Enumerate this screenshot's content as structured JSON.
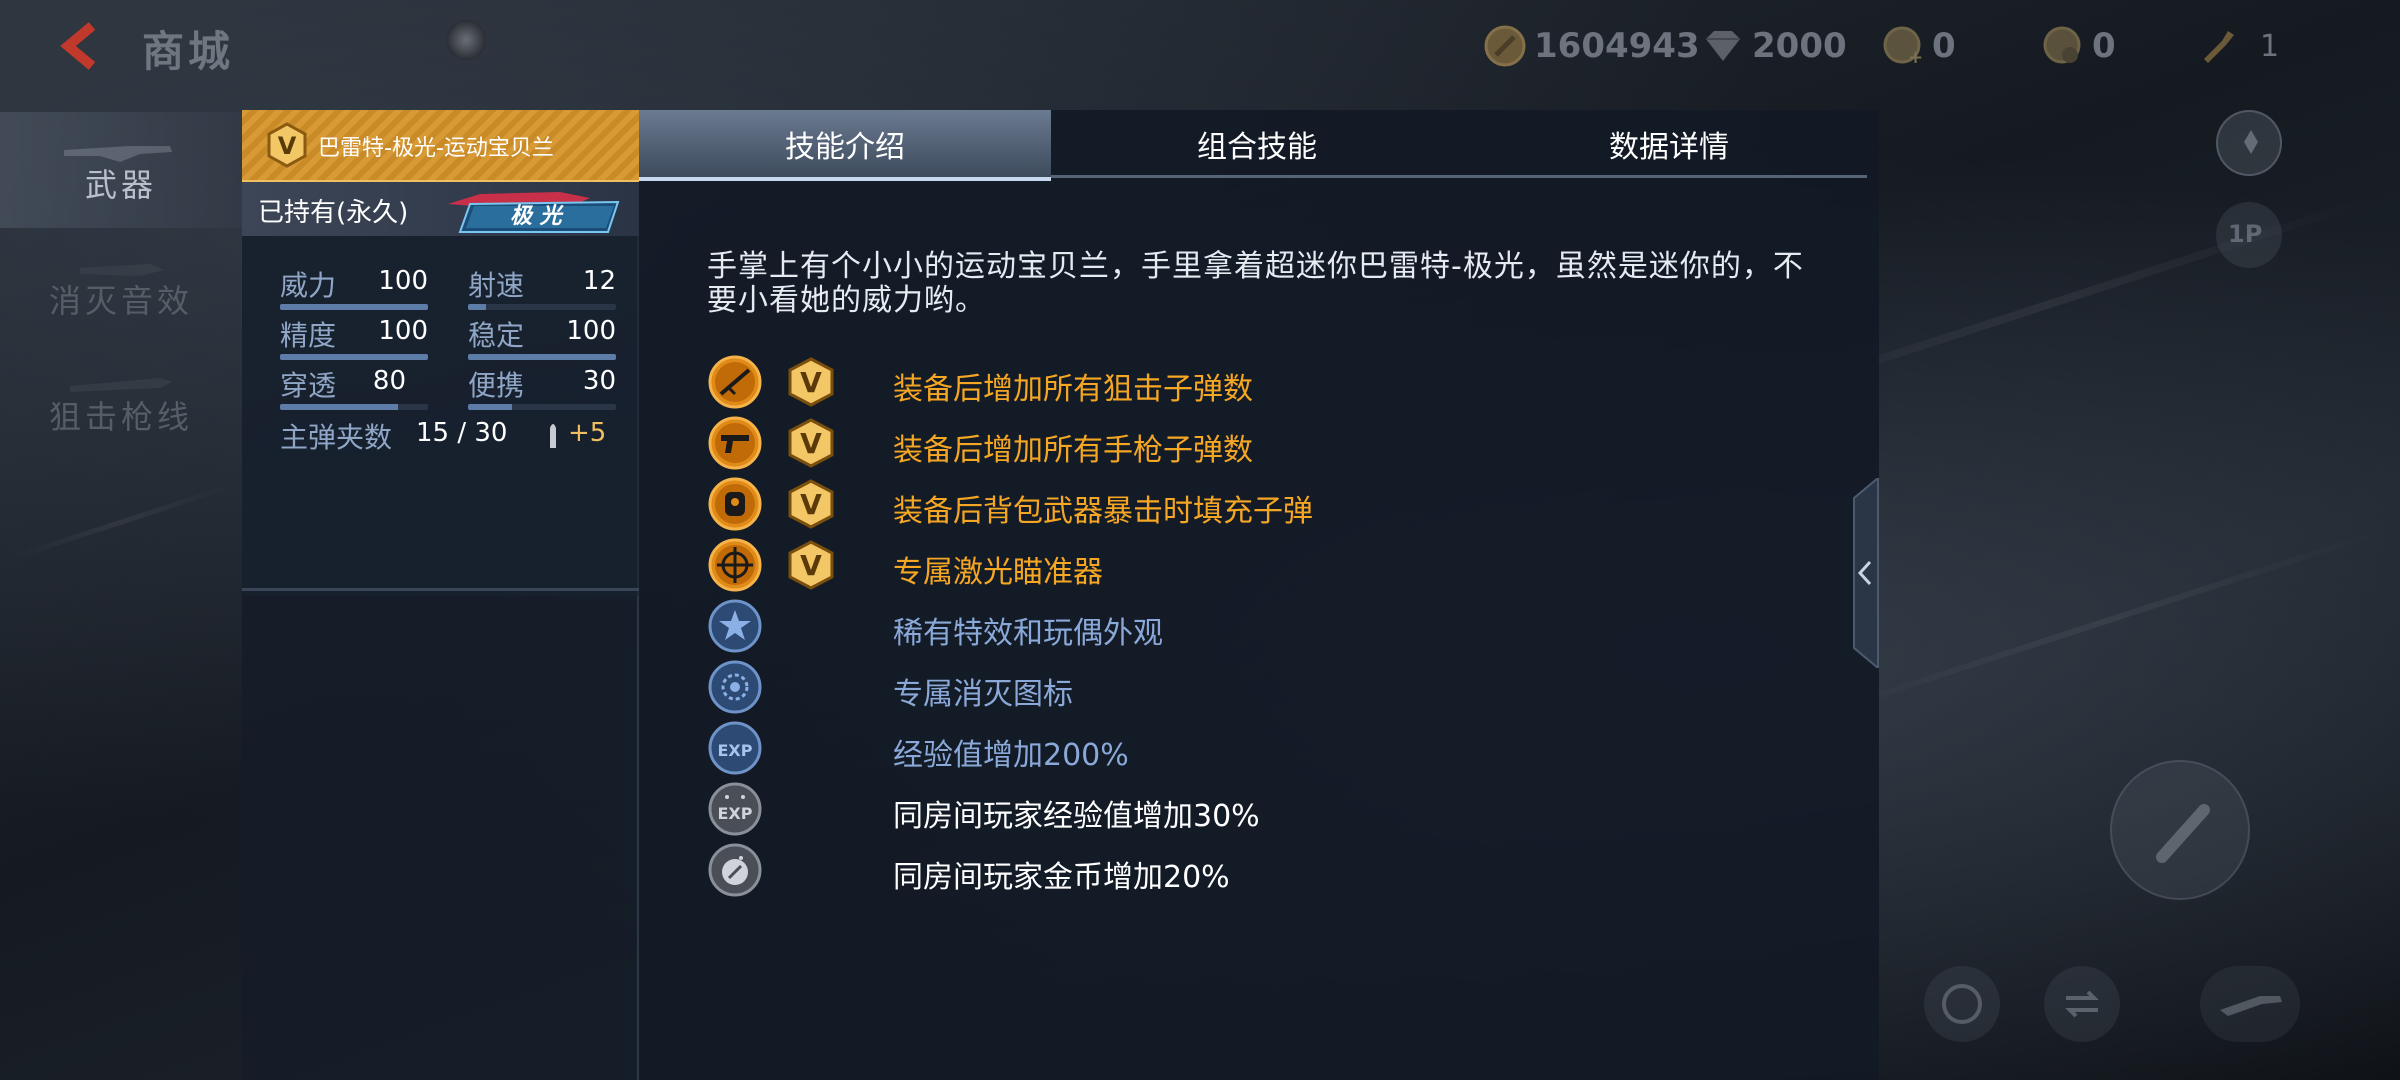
{
  "header": {
    "title": "商城",
    "currencies": [
      {
        "icon": "gold-coin-icon",
        "value": "1604943"
      },
      {
        "icon": "diamond-icon",
        "value": "2000"
      },
      {
        "icon": "ticket-plus-icon",
        "value": "0"
      },
      {
        "icon": "medal-icon",
        "value": "0"
      },
      {
        "icon": "horn-icon",
        "value": "1"
      }
    ]
  },
  "sidebar": {
    "items": [
      {
        "label": "武器",
        "active": true
      },
      {
        "label": "消灭音效",
        "active": false
      },
      {
        "label": "狙击枪线",
        "active": false
      }
    ]
  },
  "weapon": {
    "name": "巴雷特-极光-运动宝贝兰",
    "owned": "已持有(永久)",
    "badge": "极 光",
    "stats": [
      {
        "label": "威力",
        "value": "100",
        "level": 1.0
      },
      {
        "label": "射速",
        "value": "12",
        "level": 0.12
      },
      {
        "label": "精度",
        "value": "100",
        "level": 1.0
      },
      {
        "label": "稳定",
        "value": "100",
        "level": 1.0
      },
      {
        "label": "穿透",
        "value": "80",
        "level": 0.8
      },
      {
        "label": "便携",
        "value": "30",
        "level": 0.3
      }
    ],
    "magazine_label": "主弹夹数",
    "magazine_value": "15 / 30",
    "magazine_bonus": "+5"
  },
  "tabs": [
    {
      "label": "技能介绍",
      "active": true
    },
    {
      "label": "组合技能",
      "active": false
    },
    {
      "label": "数据详情",
      "active": false
    }
  ],
  "description": "手掌上有个小小的运动宝贝兰，手里拿着超迷你巴雷特-极光，虽然是迷你的，不要小看她的威力哟。",
  "skills": [
    {
      "icon": "sniper-rifle-icon",
      "vip": true,
      "text": "装备后增加所有狙击子弹数",
      "tier": "gold"
    },
    {
      "icon": "pistol-icon",
      "vip": true,
      "text": "装备后增加所有手枪子弹数",
      "tier": "gold"
    },
    {
      "icon": "backpack-crit-icon",
      "vip": true,
      "text": "装备后背包武器暴击时填充子弹",
      "tier": "gold"
    },
    {
      "icon": "crosshair-icon",
      "vip": true,
      "text": "专属激光瞄准器",
      "tier": "gold"
    },
    {
      "icon": "star-icon",
      "vip": false,
      "text": "稀有特效和玩偶外观",
      "tier": "blue"
    },
    {
      "icon": "kill-mark-icon",
      "vip": false,
      "text": "专属消灭图标",
      "tier": "blue"
    },
    {
      "icon": "exp-icon",
      "vip": false,
      "text": "经验值增加200%",
      "tier": "blue"
    },
    {
      "icon": "room-exp-icon",
      "vip": false,
      "text": "同房间玩家经验值增加30%",
      "tier": "white"
    },
    {
      "icon": "room-coin-icon",
      "vip": false,
      "text": "同房间玩家金币增加20%",
      "tier": "white"
    }
  ],
  "colors": {
    "gold": "#f5a623",
    "blue": "#8aa8d8",
    "white": "#ffffff",
    "accent": "#d89a35"
  }
}
